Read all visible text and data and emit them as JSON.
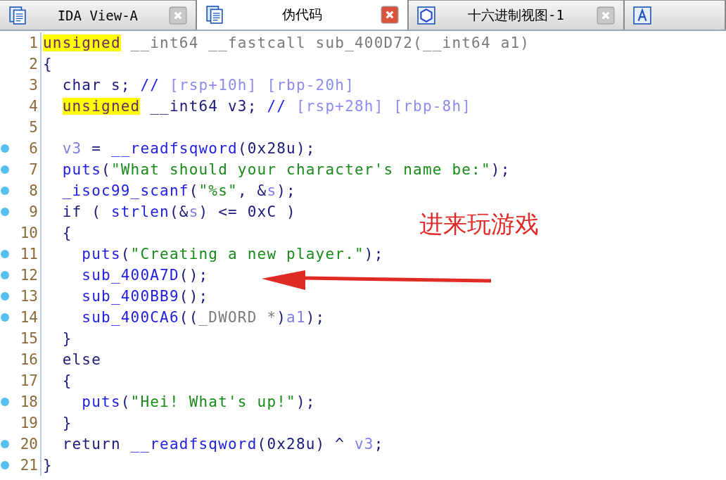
{
  "tabs": [
    {
      "label": "IDA View-A",
      "kind": "listing",
      "selected": false
    },
    {
      "label": "伪代码",
      "kind": "listing",
      "selected": true
    },
    {
      "label": "十六进制视图-1",
      "kind": "hex",
      "selected": false
    },
    {
      "kind": "struct",
      "selected": false
    }
  ],
  "code": [
    {
      "number": "1",
      "breakpoint": false,
      "tokens": [
        {
          "text": "unsigned",
          "kind": "hl-gray"
        },
        {
          "text": " __int64 __fastcall sub_400D72(__int64 a1)",
          "kind": "gray"
        }
      ]
    },
    {
      "number": "2",
      "breakpoint": false,
      "tokens": [
        {
          "text": "{",
          "kind": "plain"
        }
      ]
    },
    {
      "number": "3",
      "breakpoint": false,
      "tokens": [
        {
          "text": "  char s; ",
          "kind": "plain"
        },
        {
          "text": "//",
          "kind": "func"
        },
        {
          "text": " [rsp+10h] [rbp-20h]",
          "kind": "cmt"
        }
      ]
    },
    {
      "number": "4",
      "breakpoint": false,
      "tokens": [
        {
          "text": "  unsigned",
          "kind": "hl"
        },
        {
          "text": " __int64 v3; ",
          "kind": "plain"
        },
        {
          "text": "//",
          "kind": "func"
        },
        {
          "text": " [rsp+28h] [rbp-8h]",
          "kind": "cmt"
        }
      ]
    },
    {
      "number": "5",
      "breakpoint": false
    },
    {
      "number": "6",
      "breakpoint": true,
      "tokens": [
        {
          "text": "  v3",
          "kind": "var"
        },
        {
          "text": " = ",
          "kind": "plain"
        },
        {
          "text": "__readfsqword",
          "kind": "func"
        },
        {
          "text": "(0x28u);",
          "kind": "plain"
        }
      ]
    },
    {
      "number": "7",
      "breakpoint": true,
      "tokens": [
        {
          "text": "  puts",
          "kind": "func"
        },
        {
          "text": "(",
          "kind": "plain"
        },
        {
          "text": "\"What should your character's name be:\"",
          "kind": "str"
        },
        {
          "text": ");",
          "kind": "plain"
        }
      ]
    },
    {
      "number": "8",
      "breakpoint": true,
      "tokens": [
        {
          "text": "  _isoc99_scanf",
          "kind": "func"
        },
        {
          "text": "(",
          "kind": "plain"
        },
        {
          "text": "\"%s\"",
          "kind": "str"
        },
        {
          "text": ", &",
          "kind": "plain"
        },
        {
          "text": "s",
          "kind": "var"
        },
        {
          "text": ");",
          "kind": "plain"
        }
      ]
    },
    {
      "number": "9",
      "breakpoint": true,
      "tokens": [
        {
          "text": "  if ( ",
          "kind": "plain"
        },
        {
          "text": "strlen",
          "kind": "func"
        },
        {
          "text": "(&",
          "kind": "plain"
        },
        {
          "text": "s",
          "kind": "var"
        },
        {
          "text": ") <= 0xC )",
          "kind": "plain"
        }
      ]
    },
    {
      "number": "10",
      "breakpoint": false,
      "tokens": [
        {
          "text": "  {",
          "kind": "plain"
        }
      ]
    },
    {
      "number": "11",
      "breakpoint": true,
      "tokens": [
        {
          "text": "    puts",
          "kind": "func"
        },
        {
          "text": "(",
          "kind": "plain"
        },
        {
          "text": "\"Creating a new player.\"",
          "kind": "str"
        },
        {
          "text": ");",
          "kind": "plain"
        }
      ]
    },
    {
      "number": "12",
      "breakpoint": true,
      "tokens": [
        {
          "text": "    sub_400A7D",
          "kind": "func"
        },
        {
          "text": "();",
          "kind": "plain"
        }
      ]
    },
    {
      "number": "13",
      "breakpoint": true,
      "tokens": [
        {
          "text": "    sub_400BB9",
          "kind": "func"
        },
        {
          "text": "();",
          "kind": "plain"
        }
      ]
    },
    {
      "number": "14",
      "breakpoint": true,
      "tokens": [
        {
          "text": "    sub_400CA6",
          "kind": "func"
        },
        {
          "text": "((",
          "kind": "plain"
        },
        {
          "text": "_DWORD *",
          "kind": "gray"
        },
        {
          "text": ")",
          "kind": "plain"
        },
        {
          "text": "a1",
          "kind": "var"
        },
        {
          "text": ");",
          "kind": "plain"
        }
      ]
    },
    {
      "number": "15",
      "breakpoint": false,
      "tokens": [
        {
          "text": "  }",
          "kind": "plain"
        }
      ]
    },
    {
      "number": "16",
      "breakpoint": false,
      "tokens": [
        {
          "text": "  else",
          "kind": "plain"
        }
      ]
    },
    {
      "number": "17",
      "breakpoint": false,
      "tokens": [
        {
          "text": "  {",
          "kind": "plain"
        }
      ]
    },
    {
      "number": "18",
      "breakpoint": true,
      "tokens": [
        {
          "text": "    puts",
          "kind": "func"
        },
        {
          "text": "(",
          "kind": "plain"
        },
        {
          "text": "\"Hei! What's up!\"",
          "kind": "str"
        },
        {
          "text": ");",
          "kind": "plain"
        }
      ]
    },
    {
      "number": "19",
      "breakpoint": false,
      "tokens": [
        {
          "text": "  }",
          "kind": "plain"
        }
      ]
    },
    {
      "number": "20",
      "breakpoint": true,
      "tokens": [
        {
          "text": "  return ",
          "kind": "plain"
        },
        {
          "text": "__readfsqword",
          "kind": "func"
        },
        {
          "text": "(0x28u) ^ ",
          "kind": "plain"
        },
        {
          "text": "v3",
          "kind": "var"
        },
        {
          "text": ";",
          "kind": "plain"
        }
      ]
    },
    {
      "number": "21",
      "breakpoint": true,
      "tokens": [
        {
          "text": "}",
          "kind": "plain"
        }
      ]
    }
  ],
  "annotation": {
    "text": "进来玩游戏"
  }
}
